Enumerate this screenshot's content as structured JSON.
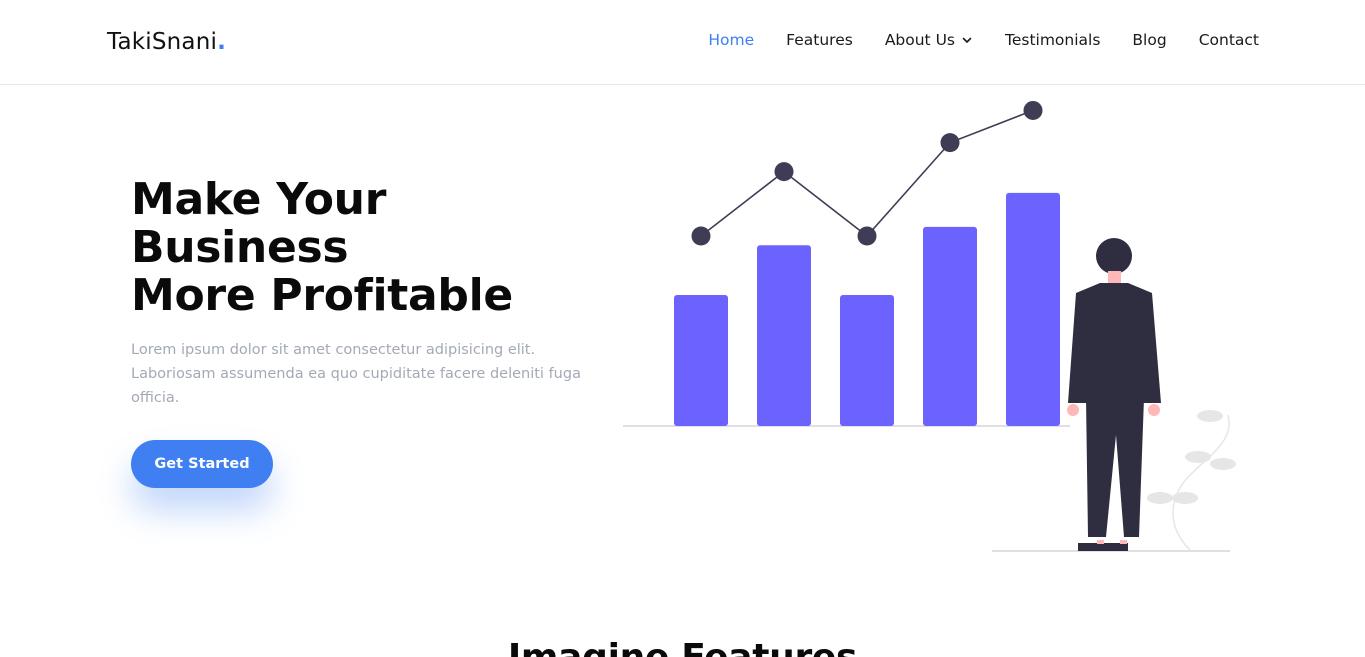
{
  "brand": {
    "name": "TakiSnani",
    "dot": ".",
    "accent": "#3f7ff1"
  },
  "nav": {
    "items": [
      {
        "label": "Home",
        "active": true
      },
      {
        "label": "Features",
        "active": false
      },
      {
        "label": "About Us",
        "active": false,
        "dropdown": true
      },
      {
        "label": "Testimonials",
        "active": false
      },
      {
        "label": "Blog",
        "active": false
      },
      {
        "label": "Contact",
        "active": false
      }
    ]
  },
  "hero": {
    "title_lines": [
      "Make Your",
      "Business",
      "More Profitable"
    ],
    "subtitle": "Lorem ipsum dolor sit amet consectetur adipisicing elit. Laboriosam assumenda ea quo cupiditate facere deleniti fuga officia.",
    "cta_label": "Get Started",
    "cta_color": "#3f7ff1"
  },
  "illustration": {
    "bar_color": "#6c63ff",
    "bar_levels": [
      0.5,
      0.69,
      0.5,
      0.76,
      0.89
    ],
    "point_levels": [
      0.59,
      0.79,
      0.59,
      0.88,
      0.98
    ],
    "person_color": "#2f2e41",
    "skin_color": "#ffb8b8",
    "plant_color": "#e6e6e6"
  },
  "features": {
    "title": "Imagine Features"
  }
}
